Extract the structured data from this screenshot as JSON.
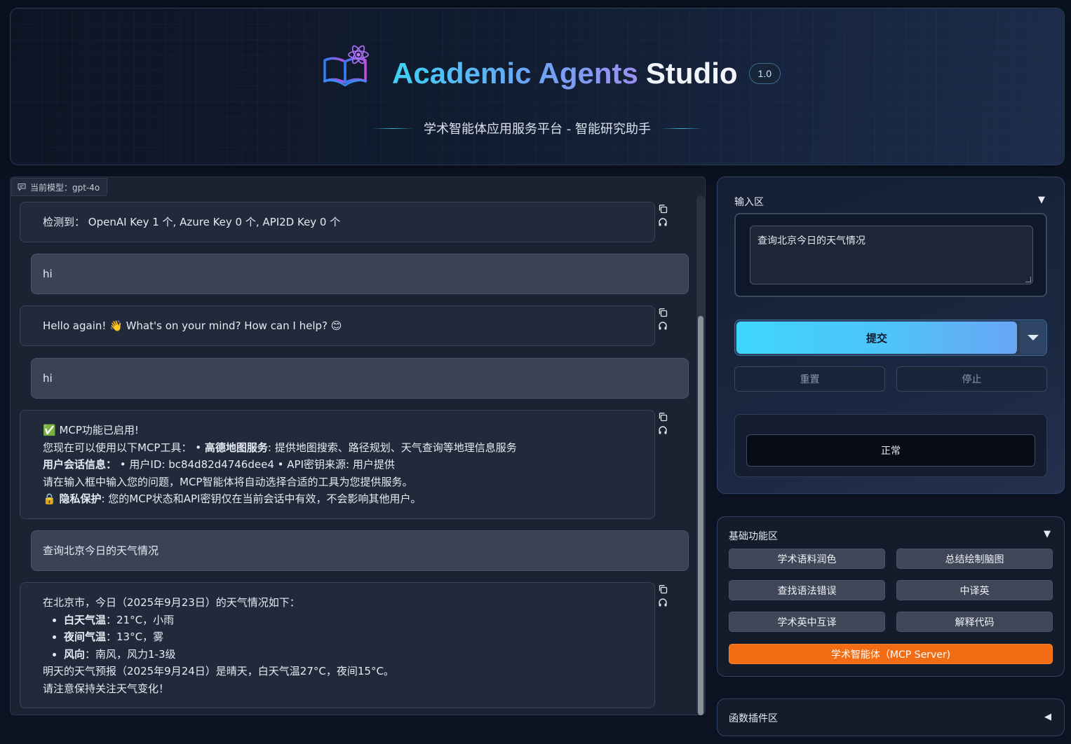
{
  "header": {
    "title_gradient": "Academic Agents",
    "title_plain": "Studio",
    "version": "1.0",
    "subtitle": "学术智能体应用服务平台 - 智能研究助手",
    "logo_icon": "book-atom-icon"
  },
  "chat": {
    "model_label": "当前模型：gpt-4o",
    "messages": [
      {
        "role": "bot",
        "text": "检测到：  OpenAI Key 1 个, Azure Key 0 个, API2D Key 0 个"
      },
      {
        "role": "user",
        "text": "hi"
      },
      {
        "role": "bot",
        "text": "Hello again! 👋 What's on your mind? How can I help? 😊"
      },
      {
        "role": "user",
        "text": "hi"
      },
      {
        "role": "bot",
        "mcp": {
          "line1": "✅ MCP功能已启用!",
          "line2_prefix": "您现在可以使用以下MCP工具：  • ",
          "line2_bold": "高德地图服务",
          "line2_suffix": ": 提供地图搜索、路径规划、天气查询等地理信息服务",
          "line3_bold": "用户会话信息：",
          "line3_suffix": "  • 用户ID: bc84d82d4746dee4  • API密钥来源: 用户提供",
          "line4": "请在输入框中输入您的问题，MCP智能体将自动选择合适的工具为您提供服务。",
          "line5_prefix": "🔒 ",
          "line5_bold": "隐私保护",
          "line5_suffix": ": 您的MCP状态和API密钥仅在当前会话中有效，不会影响其他用户。"
        }
      },
      {
        "role": "user",
        "text": "查询北京今日的天气情况"
      },
      {
        "role": "bot",
        "weather": {
          "intro": "在北京市，今日（2025年9月23日）的天气情况如下：",
          "items": [
            {
              "label": "白天气温",
              "value": "：21°C，小雨"
            },
            {
              "label": "夜间气温",
              "value": "：13°C，雾"
            },
            {
              "label": "风向",
              "value": "：南风，风力1-3级"
            }
          ],
          "forecast": "明天的天气预报（2025年9月24日）是晴天，白天气温27°C，夜间15°C。",
          "closing": "请注意保持关注天气变化！"
        }
      }
    ]
  },
  "input_area": {
    "title": "输入区",
    "textarea_value": "查询北京今日的天气情况",
    "submit_label": "提交",
    "reset_label": "重置",
    "stop_label": "停止",
    "status_text": "正常"
  },
  "basic_functions": {
    "title": "基础功能区",
    "buttons": [
      "学术语料润色",
      "总结绘制脑图",
      "查找语法错误",
      "中译英",
      "学术英中互译",
      "解释代码"
    ],
    "mcp_button": "学术智能体（MCP Server)"
  },
  "plugins": {
    "title": "函数插件区"
  },
  "colors": {
    "accent_cyan": "#3fd6fb",
    "accent_orange": "#f26c14",
    "background": "#0b1322"
  }
}
